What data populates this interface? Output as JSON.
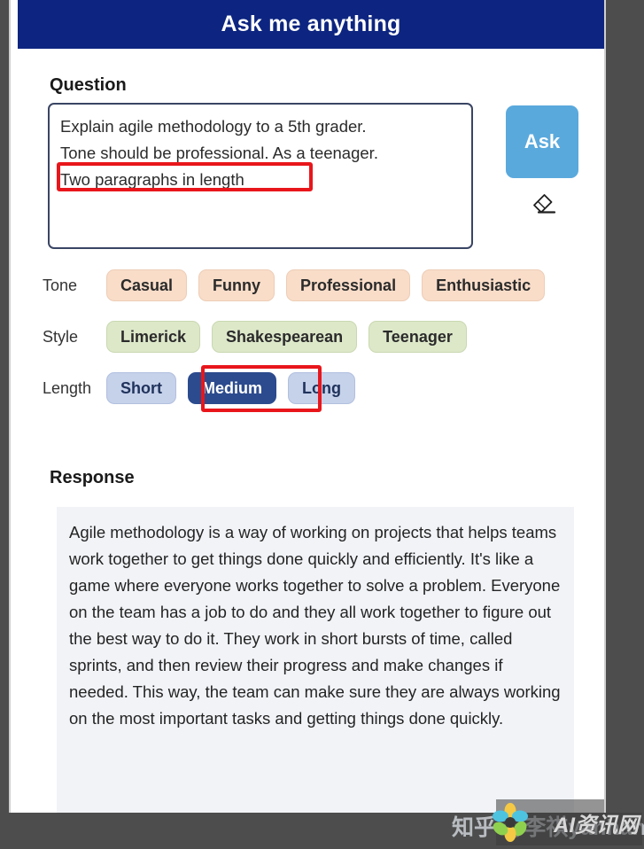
{
  "app": {
    "title": "Ask me anything",
    "header_color": "#0D2580"
  },
  "question": {
    "heading": "Question",
    "value": "Explain agile methodology to a 5th grader.\nTone should be professional. As a teenager.\nTwo paragraphs in length",
    "placeholder": "Explain agile methodology to a 5th grader."
  },
  "actions": {
    "ask_label": "Ask",
    "ask_color": "#5AA9DD",
    "clear_icon": "eraser-icon"
  },
  "options": {
    "tone": {
      "label": "Tone",
      "chips": [
        "Casual",
        "Funny",
        "Professional",
        "Enthusiastic"
      ],
      "color": "#F9DDC9",
      "selected": null
    },
    "style": {
      "label": "Style",
      "chips": [
        "Limerick",
        "Shakespearean",
        "Teenager"
      ],
      "color": "#DDE8C9",
      "selected": null
    },
    "length": {
      "label": "Length",
      "chips": [
        "Short",
        "Medium",
        "Long"
      ],
      "color": "#C6D1EA",
      "selected_color": "#2C4B8E",
      "selected": "Medium"
    }
  },
  "response": {
    "heading": "Response",
    "text": "Agile methodology is a way of working on projects that helps teams work together to get things done quickly and efficiently. It's like a game where everyone works together to solve a problem. Everyone on the team has a job to do and they all work together to figure out the best way to do it. They work in short bursts of time, called sprints, and then review their progress and make changes if needed. This way, the team can make sure they are always working on the most important tasks and getting things done quickly."
  },
  "annotations": {
    "color": "#E8161B",
    "highlighted_question_phrase": "Two paragraphs in length",
    "highlighted_length_chip": "Medium"
  },
  "watermark": {
    "zhihu": "知乎 @李祺yahhan",
    "zhihu_short": "知乎",
    "ai_site": "AI资讯网"
  }
}
